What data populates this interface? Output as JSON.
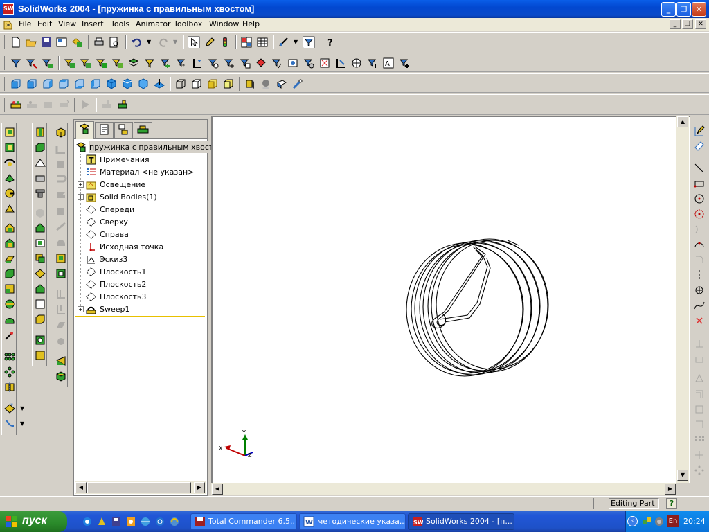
{
  "window": {
    "title": "SolidWorks 2004 - [пружинка с правильным хвостом]",
    "app_icon": "SW"
  },
  "menu": [
    "File",
    "Edit",
    "View",
    "Insert",
    "Tools",
    "Animator",
    "Toolbox",
    "Window",
    "Help"
  ],
  "tree": {
    "root": "пружинка с правильным хвостом",
    "items": [
      {
        "label": "Примечания",
        "icon": "annotations-icon",
        "expand": false
      },
      {
        "label": "Материал <не указан>",
        "icon": "material-icon",
        "expand": false
      },
      {
        "label": "Освещение",
        "icon": "lighting-icon",
        "expand": true
      },
      {
        "label": "Solid Bodies(1)",
        "icon": "solid-bodies-icon",
        "expand": true
      },
      {
        "label": "Спереди",
        "icon": "plane-icon",
        "expand": false
      },
      {
        "label": "Сверху",
        "icon": "plane-icon",
        "expand": false
      },
      {
        "label": "Справа",
        "icon": "plane-icon",
        "expand": false
      },
      {
        "label": "Исходная точка",
        "icon": "origin-icon",
        "expand": false
      },
      {
        "label": "Эскиз3",
        "icon": "sketch-icon",
        "expand": false
      },
      {
        "label": "Плоскость1",
        "icon": "plane-icon",
        "expand": false
      },
      {
        "label": "Плоскость2",
        "icon": "plane-icon",
        "expand": false
      },
      {
        "label": "Плоскость3",
        "icon": "plane-icon",
        "expand": false
      },
      {
        "label": "Sweep1",
        "icon": "sweep-icon",
        "expand": true
      }
    ]
  },
  "triad": {
    "x": "X",
    "y": "Y",
    "z": "Z"
  },
  "status": {
    "mode": "Editing Part",
    "help": "?"
  },
  "taskbar": {
    "start": "пуск",
    "tasks": [
      {
        "label": "Total Commander 6.5...",
        "active": false
      },
      {
        "label": "методические указа...",
        "active": false
      },
      {
        "label": "SolidWorks 2004 - [п...",
        "active": true
      }
    ],
    "lang": "En",
    "clock": "20:24"
  },
  "colors": {
    "accent": "#0a5ee8",
    "tree_underline": "#e8c000",
    "triad_x": "#c00000",
    "triad_y": "#008000",
    "triad_z": "#0000c0"
  }
}
